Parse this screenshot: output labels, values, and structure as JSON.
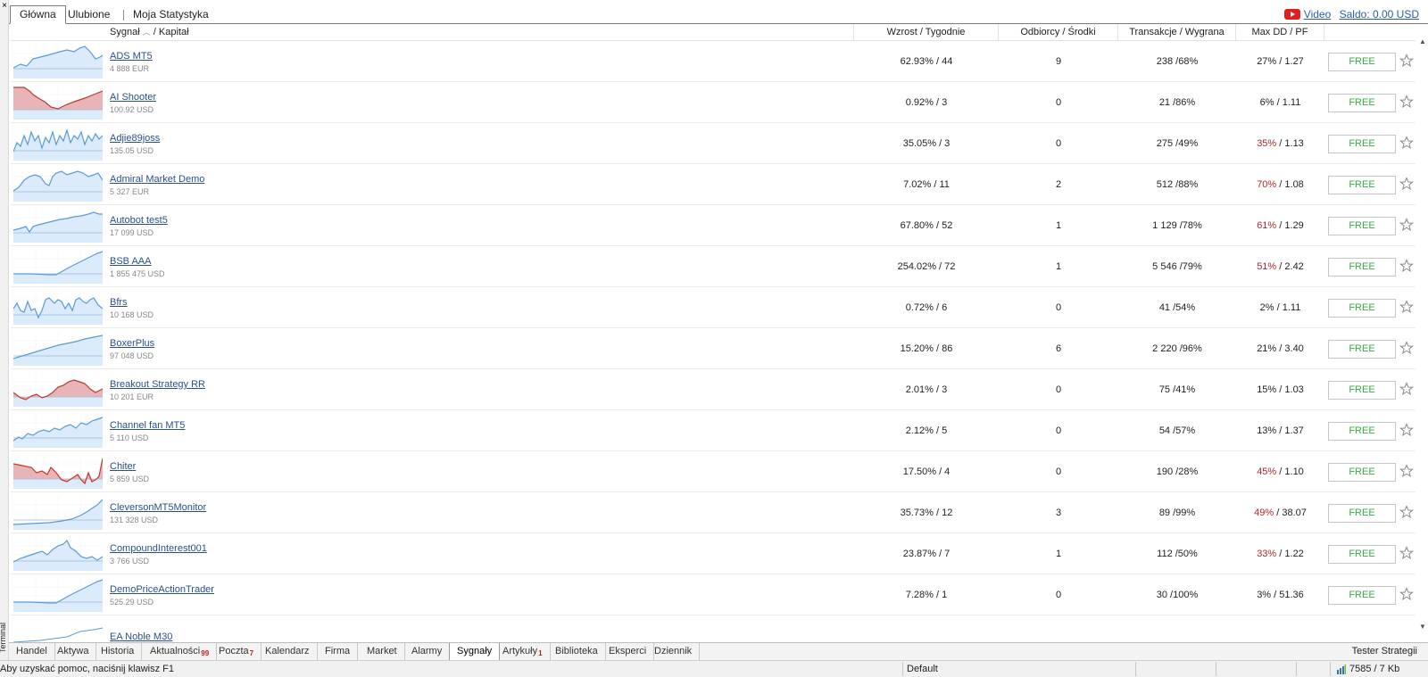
{
  "side": {
    "label": "Terminal",
    "close": "×"
  },
  "top_tabs": [
    {
      "label": "Główna"
    },
    {
      "label": "Ulubione"
    },
    {
      "label": "Moja Statystyka"
    }
  ],
  "top_right": {
    "video_label": "Video",
    "balance_label": "Saldo: 0.00 USD"
  },
  "columns": {
    "signal": "Sygnał",
    "capital": "/ Kapitał",
    "growth": "Wzrost / Tygodnie",
    "subscribers": "Odbiorcy / Środki",
    "trades": "Transakcje / Wygrana",
    "maxdd": "Max DD / PF"
  },
  "signals": [
    {
      "name": "ADS MT5",
      "capital": "4 888 EUR",
      "growth": "62.93% / 44",
      "subs": "9",
      "trades": "238 /68%",
      "dd": "27%",
      "pf": "/ 1.27",
      "dd_red": false,
      "btn": "FREE",
      "spark": "rise_dip",
      "negative": false
    },
    {
      "name": "AI Shooter",
      "capital": "100.92 USD",
      "growth": "0.92% / 3",
      "subs": "0",
      "trades": "21 /86%",
      "dd": "6%",
      "pf": "/ 1.11",
      "dd_red": false,
      "btn": "FREE",
      "spark": "dip_recover",
      "negative": true
    },
    {
      "name": "Adjie89joss",
      "capital": "135.05 USD",
      "growth": "35.05% / 3",
      "subs": "0",
      "trades": "275 /49%",
      "dd": "35%",
      "pf": "/ 1.13",
      "dd_red": true,
      "btn": "FREE",
      "spark": "volatile",
      "negative": false
    },
    {
      "name": "Admiral Market Demo",
      "capital": "5 327 EUR",
      "growth": "7.02% / 11",
      "subs": "2",
      "trades": "512 /88%",
      "dd": "70%",
      "pf": "/ 1.08",
      "dd_red": true,
      "btn": "FREE",
      "spark": "hump",
      "negative": false
    },
    {
      "name": "Autobot test5",
      "capital": "17 099 USD",
      "growth": "67.80% / 52",
      "subs": "1",
      "trades": "1 129 /78%",
      "dd": "61%",
      "pf": "/ 1.29",
      "dd_red": true,
      "btn": "FREE",
      "spark": "steady_rise",
      "negative": false
    },
    {
      "name": "BSB AAA",
      "capital": "1 855 475 USD",
      "growth": "254.02% / 72",
      "subs": "1",
      "trades": "5 546 /79%",
      "dd": "51%",
      "pf": "/ 2.42",
      "dd_red": true,
      "btn": "FREE",
      "spark": "late_rise",
      "negative": false
    },
    {
      "name": "Bfrs",
      "capital": "10 168 USD",
      "growth": "0.72% / 6",
      "subs": "0",
      "trades": "41 /54%",
      "dd": "2%",
      "pf": "/ 1.11",
      "dd_red": false,
      "btn": "FREE",
      "spark": "choppy",
      "negative": false
    },
    {
      "name": "BoxerPlus",
      "capital": "97 048 USD",
      "growth": "15.20% / 86",
      "subs": "6",
      "trades": "2 220 /96%",
      "dd": "21%",
      "pf": "/ 3.40",
      "dd_red": false,
      "btn": "FREE",
      "spark": "linear",
      "negative": false
    },
    {
      "name": "Breakout Strategy RR",
      "capital": "10 201 EUR",
      "growth": "2.01% / 3",
      "subs": "0",
      "trades": "75 /41%",
      "dd": "15%",
      "pf": "/ 1.03",
      "dd_red": false,
      "btn": "FREE",
      "spark": "dip_peak",
      "negative": true
    },
    {
      "name": "Channel fan MT5",
      "capital": "5 110 USD",
      "growth": "2.12% / 5",
      "subs": "0",
      "trades": "54 /57%",
      "dd": "13%",
      "pf": "/ 1.37",
      "dd_red": false,
      "btn": "FREE",
      "spark": "wavy_rise",
      "negative": false
    },
    {
      "name": "Chiter",
      "capital": "5 859 USD",
      "growth": "17.50% / 4",
      "subs": "0",
      "trades": "190 /28%",
      "dd": "45%",
      "pf": "/ 1.10",
      "dd_red": true,
      "btn": "FREE",
      "spark": "deep_neg",
      "negative": true
    },
    {
      "name": "CleversonMT5Monitor",
      "capital": "131 328 USD",
      "growth": "35.73% / 12",
      "subs": "3",
      "trades": "89 /99%",
      "dd": "49%",
      "pf": "/ 38.07",
      "dd_red": true,
      "btn": "FREE",
      "spark": "exp_rise",
      "negative": false
    },
    {
      "name": "CompoundInterest001",
      "capital": "3 766 USD",
      "growth": "23.87% / 7",
      "subs": "1",
      "trades": "112 /50%",
      "dd": "33%",
      "pf": "/ 1.22",
      "dd_red": true,
      "btn": "FREE",
      "spark": "peak_fall",
      "negative": false
    },
    {
      "name": "DemoPriceActionTrader",
      "capital": "525.29 USD",
      "growth": "7.28% / 1",
      "subs": "0",
      "trades": "30 /100%",
      "dd": "3%",
      "pf": "/ 51.36",
      "dd_red": false,
      "btn": "FREE",
      "spark": "late_rise",
      "negative": false
    }
  ],
  "partial_row_name": "EA Noble M30",
  "bottom_tabs": [
    {
      "label": "Handel",
      "badge": ""
    },
    {
      "label": "Aktywa",
      "badge": ""
    },
    {
      "label": "Historia",
      "badge": ""
    },
    {
      "label": "Aktualności",
      "badge": "99"
    },
    {
      "label": "Poczta",
      "badge": "7"
    },
    {
      "label": "Kalendarz",
      "badge": ""
    },
    {
      "label": "Firma",
      "badge": ""
    },
    {
      "label": "Market",
      "badge": ""
    },
    {
      "label": "Alarmy",
      "badge": ""
    },
    {
      "label": "Sygnały",
      "badge": ""
    },
    {
      "label": "Artykuły",
      "badge": "1"
    },
    {
      "label": "Biblioteka",
      "badge": ""
    },
    {
      "label": "Eksperci",
      "badge": ""
    },
    {
      "label": "Dziennik",
      "badge": ""
    }
  ],
  "active_bottom_tab": "Sygnały",
  "tester_label": "Tester Strategii",
  "status": {
    "help": "Aby uzyskać pomoc, naciśnij klawisz F1",
    "profile": "Default",
    "traffic": "7585 / 7 Kb"
  },
  "colors": {
    "link": "#2a4f8e",
    "free": "#3daa46",
    "dd_red": "#b0282c",
    "spark_line": "#5b9bd5",
    "spark_fill": "#d7e9fb",
    "neg_fill": "#e9aaaa",
    "neg_line": "#c0392b"
  }
}
